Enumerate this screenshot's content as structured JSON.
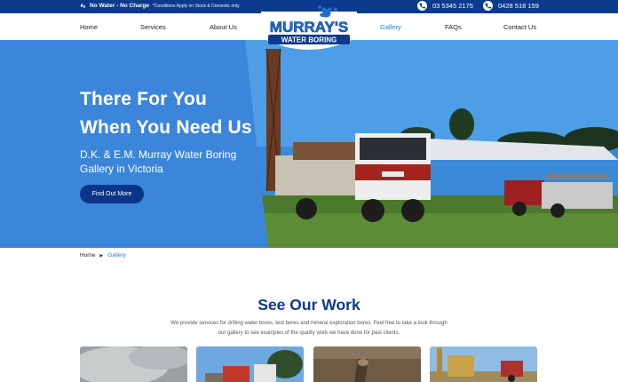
{
  "topbar": {
    "no_charge": "No Water - No Charge",
    "conditions": "*Conditions Apply on Stock & Domestic only.",
    "phone1": "03 5345 2175",
    "phone2": "0428 518 159"
  },
  "logo": {
    "line1": "MURRAY'S",
    "line2": "WATER BORING"
  },
  "nav": {
    "home": "Home",
    "services": "Services",
    "about": "About Us",
    "gallery": "Gallery",
    "faqs": "FAQs",
    "contact": "Contact Us"
  },
  "hero": {
    "line1": "There For You",
    "line2": "When You Need Us",
    "sub1": "D.K. & E.M. Murray Water Boring",
    "sub2": "Gallery in Victoria",
    "cta": "Find Out More"
  },
  "breadcrumb": {
    "home": "Home",
    "current": "Gallery"
  },
  "section": {
    "title": "See Our Work",
    "text": "We provide services for drilling water bores, test bores and mineral exploration bores. Feel free to take a look through our gallery to see examples of the quality work we have done for past clients."
  },
  "colors": {
    "brand_dark": "#0c3a8c",
    "brand_light": "#2a7bd6",
    "hero_blue": "#3b86db"
  }
}
